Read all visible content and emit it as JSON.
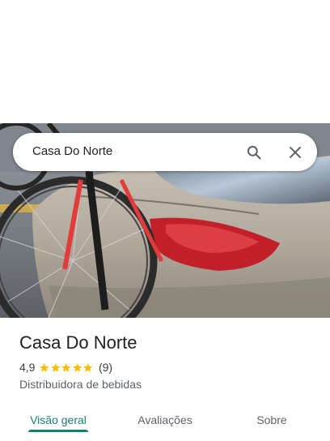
{
  "search": {
    "query": "Casa Do Norte"
  },
  "place": {
    "name": "Casa Do Norte",
    "rating": "4,9",
    "stars": 5,
    "review_count": "(9)",
    "category": "Distribuidora de bebidas"
  },
  "tabs": [
    {
      "label": "Visão geral",
      "active": true
    },
    {
      "label": "Avaliações",
      "active": false
    },
    {
      "label": "Sobre",
      "active": false
    }
  ],
  "colors": {
    "accent": "#1a7e74",
    "star": "#fbbc04",
    "text": "#202124",
    "muted": "#5f6368"
  },
  "icons": {
    "search": "search-icon",
    "close": "close-icon",
    "star": "star-icon"
  }
}
